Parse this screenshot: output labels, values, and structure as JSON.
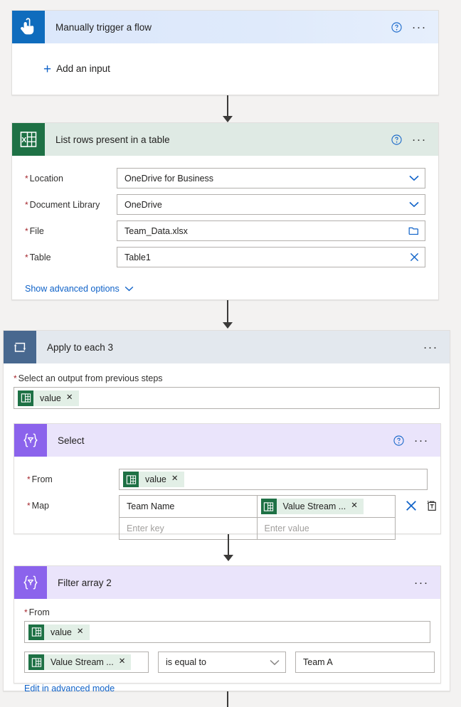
{
  "flow": {
    "cards": [
      {
        "id": "trigger",
        "title": "Manually trigger a flow",
        "icon": "touch-trigger-icon",
        "add_input_label": "Add an input",
        "help_label": "?",
        "menu_label": "..."
      },
      {
        "id": "list-rows",
        "title": "List rows present in a table",
        "icon": "excel-table-icon",
        "help_label": "?",
        "menu_label": "...",
        "fields": [
          {
            "label": "Location",
            "value": "OneDrive for Business",
            "required": true,
            "control": "dropdown"
          },
          {
            "label": "Document Library",
            "value": "OneDrive",
            "required": true,
            "control": "dropdown"
          },
          {
            "label": "File",
            "value": "Team_Data.xlsx",
            "required": true,
            "control": "file-picker"
          },
          {
            "label": "Table",
            "value": "Table1",
            "required": true,
            "control": "clearable"
          }
        ],
        "advanced_link": "Show advanced options"
      },
      {
        "id": "apply-to-each",
        "title": "Apply to each 3",
        "icon": "foreach-loop-icon",
        "menu_label": "...",
        "output_label": "Select an output from previous steps",
        "output_token": "value"
      },
      {
        "id": "select",
        "title": "Select",
        "icon": "data-operation-icon",
        "help_label": "?",
        "menu_label": "...",
        "from_label": "From",
        "from_token": "value",
        "map_label": "Map",
        "map_rows": [
          {
            "key": "Team Name",
            "value_token": "Value Stream ...",
            "key_placeholder": "",
            "value_placeholder": ""
          },
          {
            "key": "",
            "value_token": "",
            "key_placeholder": "Enter key",
            "value_placeholder": "Enter value"
          }
        ],
        "delete_row_label": "Delete row",
        "text_mode_label": "Switch to text mode"
      },
      {
        "id": "filter-array",
        "title": "Filter array 2",
        "icon": "data-operation-icon",
        "menu_label": "...",
        "from_label": "From",
        "from_token": "value",
        "condition": {
          "left_token": "Value Stream ...",
          "operator": "is equal to",
          "right_value": "Team A"
        },
        "advanced_link": "Edit in advanced mode"
      }
    ]
  },
  "colors": {
    "trigger_tile": "#0f6cbd",
    "excel_tile": "#1e7145",
    "loop_tile": "#48688f",
    "purple_tile": "#8b63ec",
    "link": "#0f62c8",
    "required": "#a4262c",
    "canvas": "#f3f2f1"
  }
}
